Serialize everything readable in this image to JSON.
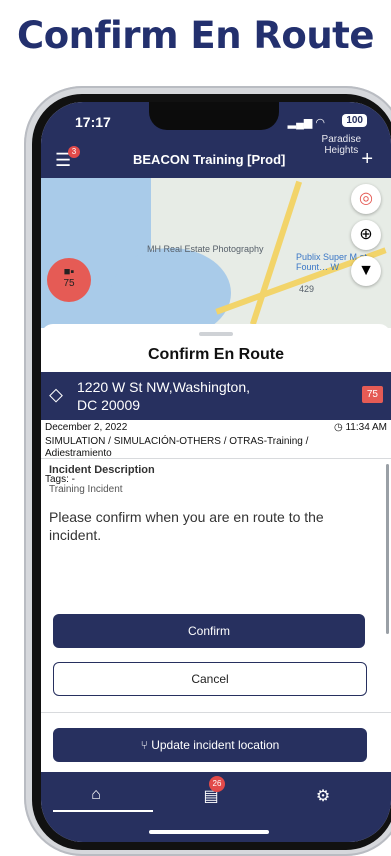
{
  "headline": "Confirm En Route",
  "status": {
    "time": "17:17",
    "battery": "100"
  },
  "appbar": {
    "title": "BEACON Training [Prod]",
    "menu_badge": "3"
  },
  "map": {
    "labels": [
      "Paradise\nHeights",
      "MH Real Estate\nPhotography",
      "Publix Super M\nat Fount… W",
      "429"
    ],
    "unit_number": "75"
  },
  "sheet": {
    "title": "Confirm En Route",
    "address": "1220 W St NW,Washington,\nDC 20009",
    "priority": "75",
    "date": "December 2, 2022",
    "time": "11:34 AM",
    "type": "SIMULATION / SIMULACIÓN-OTHERS / OTRAS-Training / Adiestramiento",
    "tags": "Tags: -",
    "incident_desc_label": "Incident Description",
    "incident_desc": "Training Incident",
    "prompt": "Please confirm when you are en route to the incident.",
    "confirm_label": "Confirm",
    "cancel_label": "Cancel",
    "update_label": "Update incident location"
  },
  "tabbar": {
    "chat_badge": "26"
  },
  "colors": {
    "navy": "#27305f",
    "headline": "#23306e",
    "alert": "#e55b55"
  },
  "icons": [
    "menu-icon",
    "plus-icon",
    "ambulance-icon",
    "lifebuoy-icon",
    "locate-icon",
    "filter-icon",
    "navigate-icon",
    "clock-icon",
    "update-location-icon",
    "home-icon",
    "chat-icon",
    "settings-icon"
  ]
}
